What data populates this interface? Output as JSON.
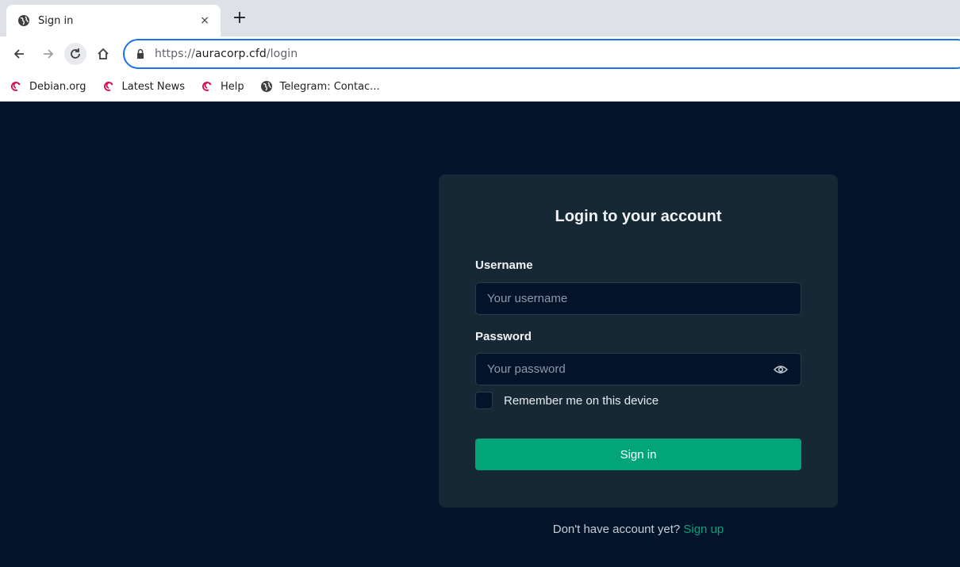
{
  "browser": {
    "tab": {
      "title": "Sign in",
      "close": "×",
      "icon": "globe-icon"
    },
    "new_tab": "+",
    "url": {
      "scheme": "https://",
      "host": "auracorp.cfd",
      "path": "/login"
    },
    "bookmarks": [
      {
        "label": "Debian.org",
        "icon": "debian-swirl-icon"
      },
      {
        "label": "Latest News",
        "icon": "debian-swirl-icon"
      },
      {
        "label": "Help",
        "icon": "debian-swirl-icon"
      },
      {
        "label": "Telegram: Contac...",
        "icon": "globe-icon"
      }
    ]
  },
  "login": {
    "title": "Login to your account",
    "username_label": "Username",
    "username_placeholder": "Your username",
    "password_label": "Password",
    "password_placeholder": "Your password",
    "remember_label": "Remember me on this device",
    "remember_checked": false,
    "submit_label": "Sign in",
    "signup_prompt": "Don't have account yet?",
    "signup_link": "Sign up"
  },
  "colors": {
    "page_bg": "#03142a",
    "card_bg": "#172835",
    "accent": "#02a57a",
    "omnibox_focus": "#1a73e8",
    "debian_red": "#d70a53"
  }
}
